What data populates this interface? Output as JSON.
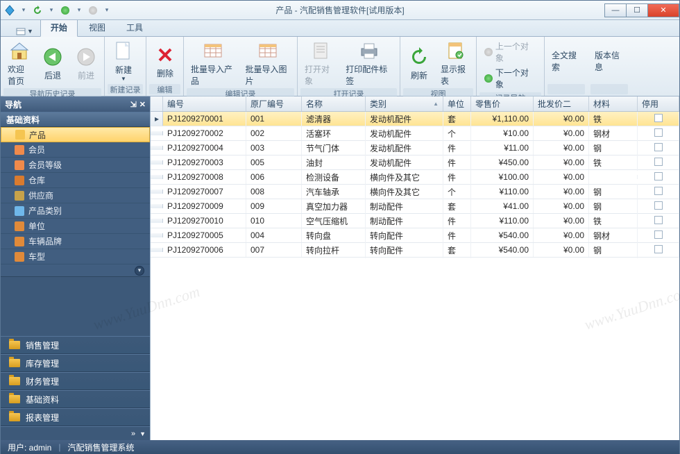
{
  "window": {
    "title": "产品 - 汽配销售管理软件[试用版本]"
  },
  "tabs": {
    "t0": "开始",
    "t1": "视图",
    "t2": "工具"
  },
  "ribbon": {
    "g1": {
      "title": "导航历史记录",
      "welcome": "欢迎首页",
      "back": "后退",
      "fwd": "前进"
    },
    "g2": {
      "title": "新建记录",
      "new": "新建"
    },
    "g3": {
      "title": "编辑",
      "del": "删除"
    },
    "g4": {
      "title": "编辑记录",
      "impProd": "批量导入产品",
      "impImg": "批量导入图片"
    },
    "g5": {
      "title": "打开记录",
      "open": "打开对象",
      "printLbl": "打印配件标签"
    },
    "g6": {
      "title": "视图",
      "refresh": "刷新",
      "report": "显示报表"
    },
    "g7": {
      "title": "记录导航",
      "prev": "上一个对象",
      "next": "下一个对象"
    },
    "search": "全文搜索",
    "ver": "版本信息"
  },
  "nav": {
    "title": "导航",
    "header": "基础资料",
    "items": [
      "产品",
      "会员",
      "会员等级",
      "仓库",
      "供应商",
      "产品类别",
      "单位",
      "车辆品牌",
      "车型"
    ],
    "cats": [
      "销售管理",
      "库存管理",
      "财务管理",
      "基础资料",
      "报表管理"
    ]
  },
  "grid": {
    "cols": {
      "c0": "编号",
      "c1": "原厂编号",
      "c2": "名称",
      "c3": "类别",
      "c4": "单位",
      "c5": "零售价",
      "c6": "批发价二",
      "c7": "材料",
      "c8": "停用"
    },
    "rows": [
      {
        "c0": "PJ1209270001",
        "c1": "001",
        "c2": "滤清器",
        "c3": "发动机配件",
        "c4": "套",
        "c5": "¥1,110.00",
        "c6": "¥0.00",
        "c7": "铁"
      },
      {
        "c0": "PJ1209270002",
        "c1": "002",
        "c2": "活塞环",
        "c3": "发动机配件",
        "c4": "个",
        "c5": "¥10.00",
        "c6": "¥0.00",
        "c7": "钢材"
      },
      {
        "c0": "PJ1209270004",
        "c1": "003",
        "c2": "节气门体",
        "c3": "发动机配件",
        "c4": "件",
        "c5": "¥11.00",
        "c6": "¥0.00",
        "c7": "钢"
      },
      {
        "c0": "PJ1209270003",
        "c1": "005",
        "c2": "油封",
        "c3": "发动机配件",
        "c4": "件",
        "c5": "¥450.00",
        "c6": "¥0.00",
        "c7": "铁"
      },
      {
        "c0": "PJ1209270008",
        "c1": "006",
        "c2": "检测设备",
        "c3": "横向件及其它",
        "c4": "件",
        "c5": "¥100.00",
        "c6": "¥0.00",
        "c7": ""
      },
      {
        "c0": "PJ1209270007",
        "c1": "008",
        "c2": "汽车轴承",
        "c3": "横向件及其它",
        "c4": "个",
        "c5": "¥110.00",
        "c6": "¥0.00",
        "c7": "钢"
      },
      {
        "c0": "PJ1209270009",
        "c1": "009",
        "c2": "真空加力器",
        "c3": "制动配件",
        "c4": "套",
        "c5": "¥41.00",
        "c6": "¥0.00",
        "c7": "钢"
      },
      {
        "c0": "PJ1209270010",
        "c1": "010",
        "c2": "空气压缩机",
        "c3": "制动配件",
        "c4": "件",
        "c5": "¥110.00",
        "c6": "¥0.00",
        "c7": "铁"
      },
      {
        "c0": "PJ1209270005",
        "c1": "004",
        "c2": "转向盘",
        "c3": "转向配件",
        "c4": "件",
        "c5": "¥540.00",
        "c6": "¥0.00",
        "c7": "钢材"
      },
      {
        "c0": "PJ1209270006",
        "c1": "007",
        "c2": "转向拉杆",
        "c3": "转向配件",
        "c4": "套",
        "c5": "¥540.00",
        "c6": "¥0.00",
        "c7": "钢"
      }
    ]
  },
  "status": {
    "user": "用户: admin",
    "app": "汽配销售管理系统"
  },
  "watermark": "www.YuuDnn.com"
}
